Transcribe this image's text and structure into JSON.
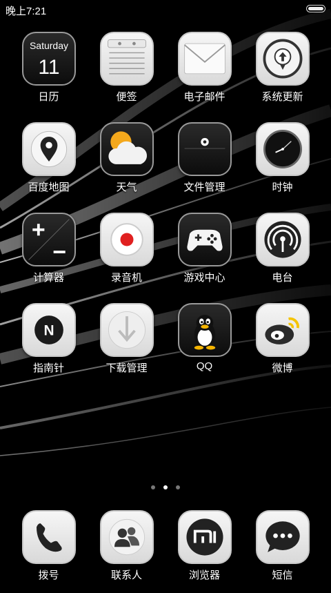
{
  "status_bar": {
    "time": "晚上7:21"
  },
  "apps": [
    {
      "id": "calendar",
      "label": "日历",
      "icon": "calendar-icon",
      "weekday": "Saturday",
      "day": "11"
    },
    {
      "id": "notes",
      "label": "便签",
      "icon": "notepad-icon"
    },
    {
      "id": "email",
      "label": "电子邮件",
      "icon": "envelope-icon"
    },
    {
      "id": "updater",
      "label": "系统更新",
      "icon": "upload-arrow-icon"
    },
    {
      "id": "maps",
      "label": "百度地图",
      "icon": "map-pin-icon"
    },
    {
      "id": "weather",
      "label": "天气",
      "icon": "sun-cloud-icon"
    },
    {
      "id": "files",
      "label": "文件管理",
      "icon": "folder-icon"
    },
    {
      "id": "clock",
      "label": "时钟",
      "icon": "clock-icon"
    },
    {
      "id": "calculator",
      "label": "计算器",
      "icon": "plus-minus-icon"
    },
    {
      "id": "recorder",
      "label": "录音机",
      "icon": "record-icon"
    },
    {
      "id": "games",
      "label": "游戏中心",
      "icon": "gamepad-icon"
    },
    {
      "id": "radio",
      "label": "电台",
      "icon": "broadcast-icon"
    },
    {
      "id": "compass",
      "label": "指南针",
      "icon": "compass-icon"
    },
    {
      "id": "downloads",
      "label": "下载管理",
      "icon": "download-arrow-icon"
    },
    {
      "id": "qq",
      "label": "QQ",
      "icon": "penguin-icon"
    },
    {
      "id": "weibo",
      "label": "微博",
      "icon": "weibo-icon"
    }
  ],
  "dock": [
    {
      "id": "phone",
      "label": "拨号",
      "icon": "phone-icon"
    },
    {
      "id": "contacts",
      "label": "联系人",
      "icon": "contacts-icon"
    },
    {
      "id": "browser",
      "label": "浏览器",
      "icon": "mi-logo-icon"
    },
    {
      "id": "messages",
      "label": "短信",
      "icon": "chat-bubble-icon"
    }
  ],
  "page_indicator": {
    "pages": 3,
    "current": 2
  },
  "colors": {
    "background": "#000000",
    "accent_red": "#e02020",
    "weather_sun": "#f4a81c",
    "weibo_yellow": "#f5c400"
  }
}
